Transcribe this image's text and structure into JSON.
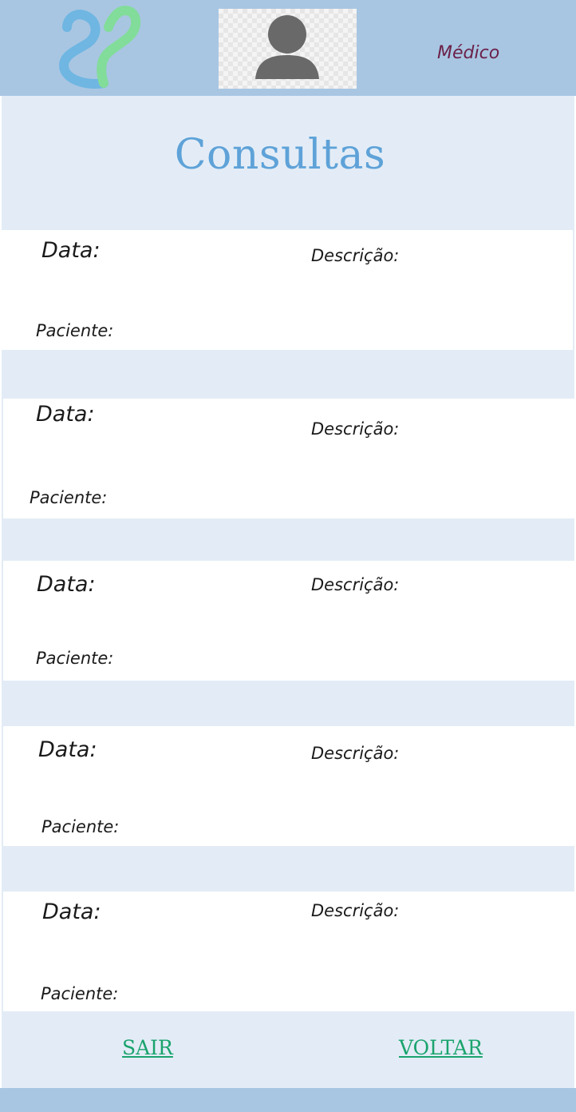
{
  "header": {
    "logo_icon": "heart-s-logo-icon",
    "avatar_icon": "user-placeholder-icon",
    "role": "Médico"
  },
  "page": {
    "title": "Consultas"
  },
  "consultations": [
    {
      "data_label": "Data:",
      "descricao_label": "Descrição:",
      "paciente_label": "Paciente:"
    },
    {
      "data_label": "Data:",
      "descricao_label": "Descrição:",
      "paciente_label": "Paciente:"
    },
    {
      "data_label": "Data:",
      "descricao_label": "Descrição:",
      "paciente_label": "Paciente:"
    },
    {
      "data_label": "Data:",
      "descricao_label": "Descrição:",
      "paciente_label": "Paciente:"
    },
    {
      "data_label": "Data:",
      "descricao_label": "Descrição:",
      "paciente_label": "Paciente:"
    }
  ],
  "actions": {
    "sair": "SAIR",
    "voltar": "VOLTAR"
  },
  "colors": {
    "header_bg": "#a8c6e2",
    "content_bg": "#e3ecf6",
    "title": "#5ea2d8",
    "role": "#6b2149",
    "action_link": "#1aa36d"
  }
}
